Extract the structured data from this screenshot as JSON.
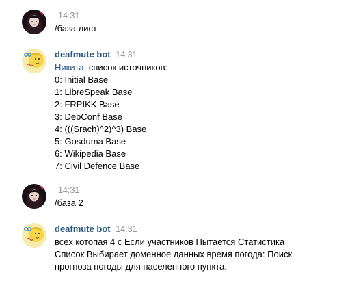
{
  "messages": [
    {
      "author": "",
      "time": "14:31",
      "text": "/база лист"
    },
    {
      "author": "deafmute bot",
      "time": "14:31",
      "mention": "Никита",
      "intro": ", список источников:",
      "lines": [
        "0: Initial Base",
        "1: LibreSpeak Base",
        "2: FRPIKK Base",
        "3: DebConf Base",
        "4: (((Srach)^2)^3) Base",
        "5: Gosduma Base",
        "6: Wikipedia Base",
        "7: Civil Defence Base"
      ]
    },
    {
      "author": "",
      "time": "14:31",
      "text": "/база 2"
    },
    {
      "author": "deafmute bot",
      "time": "14:31",
      "text_lines": [
        "всех котопая 4 с Если участников Пытается Статистика",
        "Список Выбирает доменное данных время погода: Поиск",
        "прогноза погоды для населенного пункта."
      ]
    }
  ]
}
